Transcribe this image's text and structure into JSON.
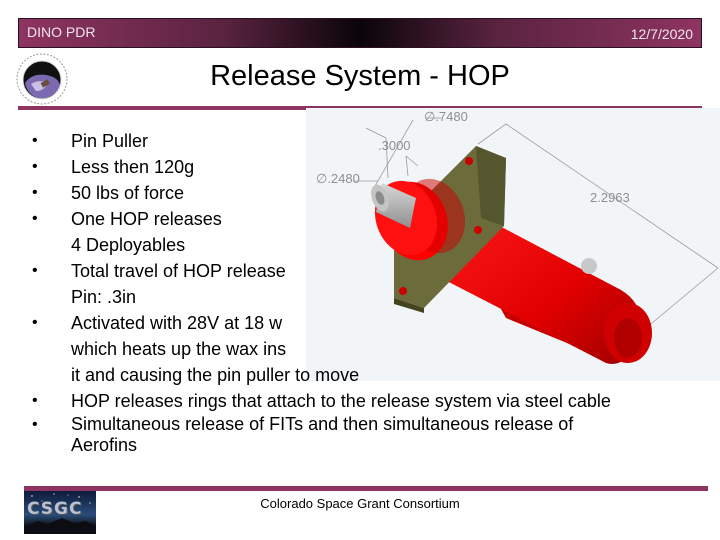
{
  "header": {
    "left_label": "DINO PDR",
    "date": "12/7/2020"
  },
  "colors": {
    "accent": "#8e3461",
    "part_red": "#e60000",
    "flange_olive": "#6b6b3c",
    "pin_gray": "#b8b8b8"
  },
  "logos": {
    "top_left": "nasa-space-grant-seal",
    "footer": "csgc-logo",
    "footer_text": "CSGC"
  },
  "title": "Release System - HOP",
  "bullets": [
    {
      "text": "Pin Puller",
      "continuation": []
    },
    {
      "text": "Less then 120g",
      "continuation": []
    },
    {
      "text": "50 lbs of force",
      "continuation": []
    },
    {
      "text": "One HOP releases",
      "continuation": [
        "4 Deployables"
      ]
    },
    {
      "text": "Total travel of HOP release",
      "continuation": [
        "Pin: .3in"
      ]
    },
    {
      "text": "Activated with 28V at 18 w",
      "continuation": [
        "which heats up the wax ins",
        "it and causing the pin puller to move"
      ]
    },
    {
      "text": "HOP releases rings that attach to the release system via steel cable",
      "continuation": []
    },
    {
      "text": "Simultaneous release of FITs and then simultaneous release of",
      "continuation": [
        "Aerofins"
      ]
    }
  ],
  "cad_drawing": {
    "dimensions": {
      "flange_diameter": "∅.7480",
      "pin_length": ".3000",
      "pin_diameter": "∅.2480",
      "body_length": "2.2963"
    }
  },
  "footer": {
    "organization": "Colorado Space Grant Consortium"
  }
}
